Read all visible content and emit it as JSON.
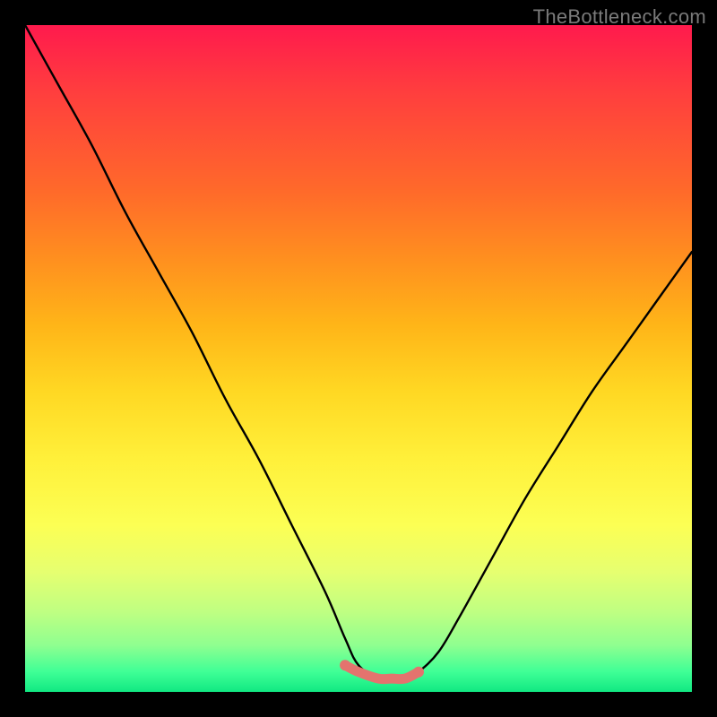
{
  "watermark": "TheBottleneck.com",
  "chart_data": {
    "type": "line",
    "title": "",
    "xlabel": "",
    "ylabel": "",
    "xlim": [
      0,
      100
    ],
    "ylim": [
      0,
      100
    ],
    "grid": false,
    "legend": false,
    "series": [
      {
        "name": "bottleneck-curve",
        "color": "#000000",
        "x": [
          0,
          5,
          10,
          15,
          20,
          25,
          30,
          35,
          40,
          45,
          48,
          50,
          53,
          55,
          57,
          59,
          62,
          65,
          70,
          75,
          80,
          85,
          90,
          95,
          100
        ],
        "y": [
          100,
          91,
          82,
          72,
          63,
          54,
          44,
          35,
          25,
          15,
          8,
          4,
          2,
          2,
          2,
          3,
          6,
          11,
          20,
          29,
          37,
          45,
          52,
          59,
          66
        ]
      },
      {
        "name": "optimal-band",
        "color": "#e4736e",
        "x": [
          48,
          50,
          53,
          55,
          57,
          59
        ],
        "y": [
          4,
          3,
          2,
          2,
          2,
          3
        ]
      }
    ],
    "background_gradient": {
      "top": "#ff1a4d",
      "mid": "#ffd823",
      "bottom": "#11e882"
    }
  }
}
